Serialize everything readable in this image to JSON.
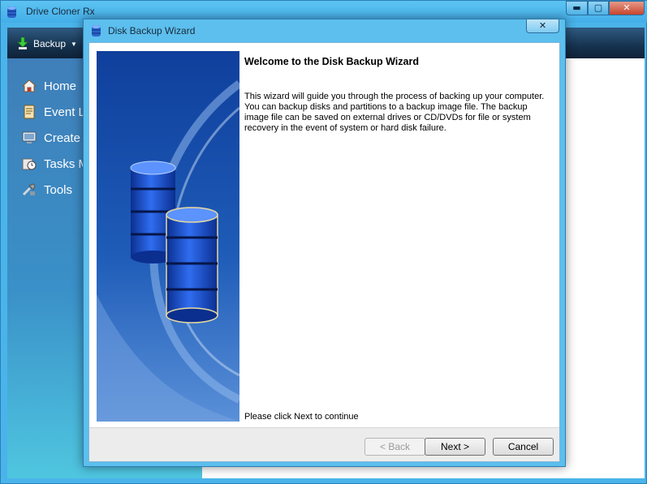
{
  "app": {
    "title": "Drive Cloner Rx",
    "window_buttons": {
      "minimize": "▬",
      "maximize": "▢",
      "close": "✕"
    }
  },
  "toolbar": {
    "backup_label": "Backup",
    "caret": "▼"
  },
  "sidebar": {
    "items": [
      {
        "label": "Home",
        "icon": "home-icon"
      },
      {
        "label": "Event Lo",
        "icon": "event-log-icon"
      },
      {
        "label": "Create F",
        "icon": "create-icon"
      },
      {
        "label": "Tasks M",
        "icon": "tasks-icon"
      },
      {
        "label": "Tools",
        "icon": "tools-icon"
      }
    ]
  },
  "wizard": {
    "title": "Disk Backup Wizard",
    "close": "✕",
    "heading": "Welcome to the Disk Backup Wizard",
    "description": "This wizard will guide you through the process of backing up your computer. You can backup disks and partitions to a backup image file. The backup image file can be saved on external drives or CD/DVDs for file or system recovery in the event of system or hard disk failure.",
    "hint": "Please click Next to continue",
    "buttons": {
      "back": "< Back",
      "next": "Next >",
      "cancel": "Cancel"
    }
  },
  "colors": {
    "title_bar": "#4ab4ea",
    "toolbar": "#16324e",
    "sidebar": "#3f7fb9",
    "disk_blue": "#1e5bd0"
  }
}
